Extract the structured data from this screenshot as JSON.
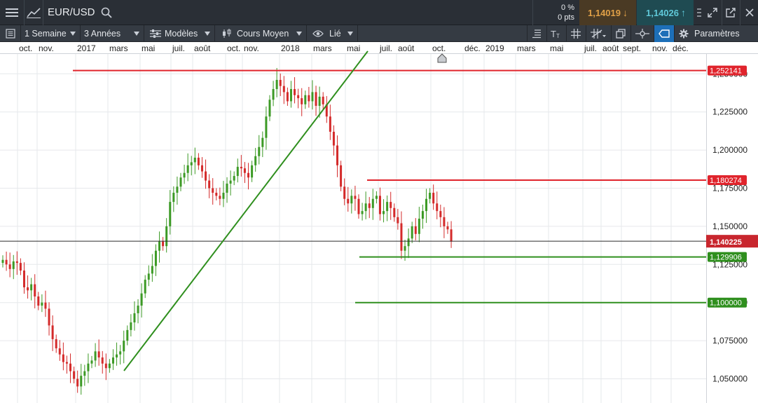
{
  "topbar": {
    "symbol": "EUR/USD",
    "change_pct": "0 %",
    "change_pts": "0 pts",
    "sell_price": "1,14019",
    "buy_price": "1,14026"
  },
  "toolbar": {
    "interval": "1 Semaine",
    "range": "3 Années",
    "models": "Modèles",
    "price_type": "Cours Moyen",
    "link": "Lié",
    "settings": "Paramètres"
  },
  "time_axis": [
    "oct.",
    "nov.",
    "2017",
    "mars",
    "mai",
    "juil.",
    "août",
    "oct.",
    "nov.",
    "2018",
    "mars",
    "mai",
    "juil.",
    "août",
    "oct.",
    "déc.",
    "2019",
    "mars",
    "mai",
    "juil.",
    "août",
    "sept.",
    "nov.",
    "déc."
  ],
  "chart_data": {
    "type": "candlestick",
    "symbol": "EUR/USD",
    "y_ticks": [
      "1,050000",
      "1,075000",
      "1,100000",
      "1,125000",
      "1,150000",
      "1,175000",
      "1,200000",
      "1,225000",
      "1,250000"
    ],
    "ylim": [
      1.04,
      1.261
    ],
    "current_price": {
      "label": "1,140225",
      "value": 1.140225,
      "color": "#c8262e"
    },
    "levels": [
      {
        "label": "1,252141",
        "value": 1.252141,
        "color": "#e0242c"
      },
      {
        "label": "1,180274",
        "value": 1.180274,
        "color": "#e0242c"
      },
      {
        "label": "1,129906",
        "value": 1.129906,
        "color": "#2f8f1e"
      },
      {
        "label": "1,100000",
        "value": 1.1,
        "color": "#2f8f1e"
      }
    ],
    "trendline": {
      "from": {
        "date": "2017-03",
        "value": 1.055
      },
      "to": {
        "date": "2018-05",
        "value": 1.26
      },
      "color": "#2f8f1e"
    },
    "closes": [
      1.128,
      1.125,
      1.122,
      1.127,
      1.126,
      1.121,
      1.11,
      1.108,
      1.112,
      1.104,
      1.098,
      1.1,
      1.096,
      1.085,
      1.076,
      1.07,
      1.066,
      1.061,
      1.06,
      1.055,
      1.05,
      1.045,
      1.052,
      1.055,
      1.06,
      1.062,
      1.068,
      1.064,
      1.06,
      1.057,
      1.06,
      1.064,
      1.066,
      1.068,
      1.075,
      1.082,
      1.087,
      1.093,
      1.098,
      1.106,
      1.115,
      1.119,
      1.124,
      1.134,
      1.14,
      1.137,
      1.15,
      1.166,
      1.172,
      1.176,
      1.182,
      1.185,
      1.19,
      1.192,
      1.195,
      1.19,
      1.186,
      1.18,
      1.175,
      1.172,
      1.17,
      1.168,
      1.172,
      1.178,
      1.18,
      1.183,
      1.189,
      1.188,
      1.185,
      1.182,
      1.19,
      1.196,
      1.202,
      1.208,
      1.222,
      1.233,
      1.24,
      1.246,
      1.242,
      1.238,
      1.232,
      1.24,
      1.236,
      1.234,
      1.23,
      1.236,
      1.232,
      1.238,
      1.229,
      1.235,
      1.23,
      1.222,
      1.212,
      1.203,
      1.19,
      1.176,
      1.168,
      1.165,
      1.17,
      1.168,
      1.158,
      1.16,
      1.165,
      1.162,
      1.168,
      1.17,
      1.158,
      1.16,
      1.166,
      1.162,
      1.156,
      1.152,
      1.134,
      1.137,
      1.142,
      1.15,
      1.145,
      1.155,
      1.16,
      1.168,
      1.172,
      1.165,
      1.16,
      1.156,
      1.15,
      1.148,
      1.14
    ]
  }
}
